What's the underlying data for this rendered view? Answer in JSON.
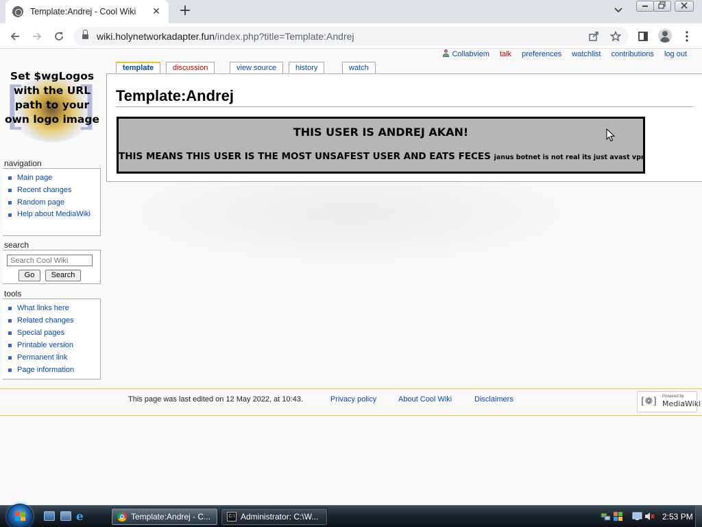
{
  "browser": {
    "tab_title": "Template:Andrej - Cool Wiki",
    "tab_close": "✕",
    "new_tab": "+",
    "url_host": "wiki.holynetworkadapter.fun",
    "url_path": "/index.php?title=Template:Andrej"
  },
  "wiki": {
    "logo_text": "Set $wgLogos with the URL path to your own logo image",
    "personal": {
      "user": "Collabviem",
      "talk": "talk",
      "preferences": "preferences",
      "watchlist": "watchlist",
      "contributions": "contributions",
      "logout": "log out"
    },
    "tabs": {
      "template": "template",
      "discussion": "discussion",
      "view_source": "view source",
      "history": "history",
      "watch": "watch"
    },
    "navigation": {
      "heading": "navigation",
      "items": [
        "Main page",
        "Recent changes",
        "Random page",
        "Help about MediaWiki"
      ]
    },
    "search": {
      "heading": "search",
      "placeholder": "Search Cool Wiki",
      "go": "Go",
      "search": "Search"
    },
    "tools": {
      "heading": "tools",
      "items": [
        "What links here",
        "Related changes",
        "Special pages",
        "Printable version",
        "Permanent link",
        "Page information"
      ]
    },
    "title": "Template:Andrej",
    "userbox": {
      "headline": "THIS USER IS ANDREJ AKAN!",
      "line": "THIS MEANS THIS USER IS THE MOST UNSAFEST USER AND EATS FECES",
      "small": "janus botnet is not real its just avast vpn"
    },
    "footer": {
      "last_edited": "This page was last edited on 12 May 2022, at 10:43.",
      "privacy": "Privacy policy",
      "about": "About Cool Wiki",
      "disclaimers": "Disclaimers",
      "powered_small": "Powered by",
      "powered_big": "MediaWiki"
    }
  },
  "taskbar": {
    "tasks": [
      {
        "label": "Template:Andrej - C...",
        "active": true
      },
      {
        "label": "Administrator: C:\\W...",
        "active": false
      }
    ],
    "clock": "2:53 PM"
  }
}
